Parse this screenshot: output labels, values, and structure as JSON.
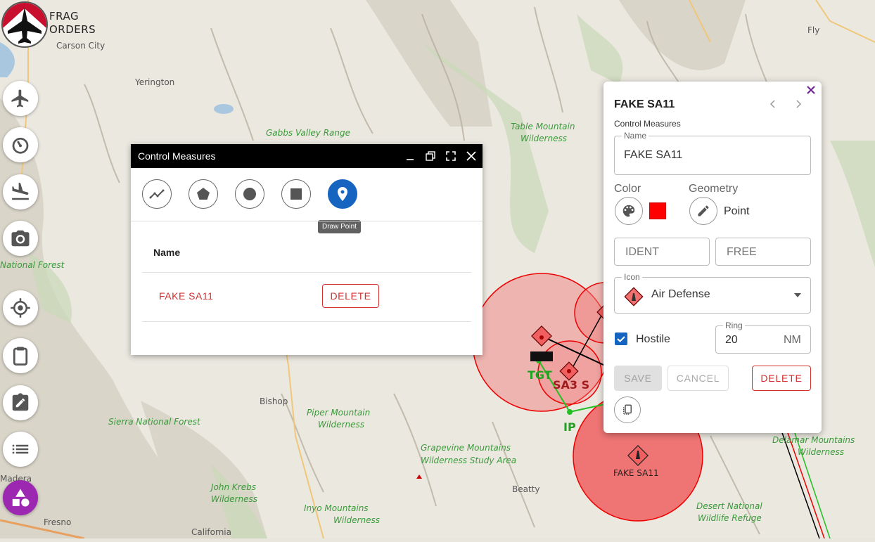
{
  "app": {
    "logo_text_line1": "Frag",
    "logo_text_line2": "Orders"
  },
  "map_labels": {
    "carson_city": "Carson City",
    "yerington": "Yerington",
    "gabbs_valley": "Gabbs Valley Range",
    "table_mountain_1": "Table Mountain",
    "table_mountain_2": "Wilderness",
    "fly": "Fly",
    "national_forest": "National Forest",
    "bishop": "Bishop",
    "piper_mountain_1": "Piper Mountain",
    "piper_mountain_2": "Wilderness",
    "sierra_forest": "Sierra National Forest",
    "grapevine_1": "Grapevine Mountains",
    "grapevine_2": "Wilderness Study Area",
    "beatty": "Beatty",
    "madera": "Madera",
    "fresno": "Fresno",
    "california": "California",
    "john_krebs_1": "John Krebs",
    "john_krebs_2": "Wilderness",
    "inyo_1": "Inyo Mountains",
    "inyo_2": "Wilderness",
    "desert_refuge_1": "Desert National",
    "desert_refuge_2": "Wildlife Refuge",
    "delamar_1": "Delamar Mountains",
    "delamar_2": "Wilderness",
    "sa3": "SA3 S",
    "tgt": "TGT",
    "ip": "IP",
    "fake_sa11": "FAKE SA11"
  },
  "rail": {
    "items": [
      "aircraft",
      "gauge",
      "landing",
      "camera",
      "target",
      "clipboard",
      "edit",
      "list",
      "shapes"
    ]
  },
  "control_measures": {
    "title": "Control Measures",
    "tooltip": "Draw Point",
    "column_name": "Name",
    "rows": [
      {
        "name": "FAKE SA11",
        "delete_label": "DELETE"
      }
    ]
  },
  "panel": {
    "title": "FAKE SA11",
    "subtitle": "Control Measures",
    "name_label": "Name",
    "name_value": "FAKE SA11",
    "color_label": "Color",
    "color_value": "#ff0000",
    "geometry_label": "Geometry",
    "geometry_value": "Point",
    "ident_placeholder": "IDENT",
    "free_placeholder": "FREE",
    "icon_label": "Icon",
    "icon_value": "Air Defense",
    "hostile_label": "Hostile",
    "hostile_checked": true,
    "ring_label": "Ring",
    "ring_value": "20",
    "ring_unit": "NM",
    "save_label": "SAVE",
    "cancel_label": "CANCEL",
    "delete_label": "DELETE"
  },
  "colors": {
    "accent": "#9c27b0",
    "danger": "#d32f2f",
    "primary": "#1565c0",
    "hostile_fill": "#f07070"
  }
}
